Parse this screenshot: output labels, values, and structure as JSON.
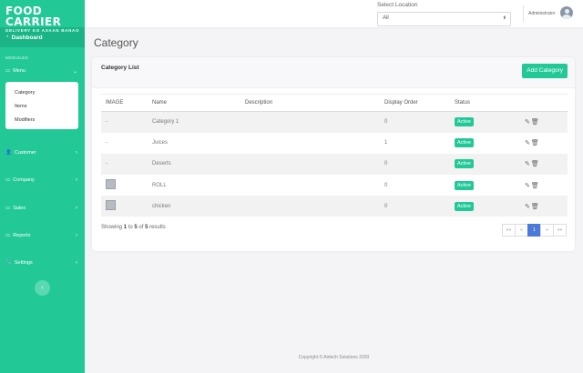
{
  "brand": {
    "title": "FOOD CARRIER",
    "subtitle": "DELIVERY KO ASAAN BANAO"
  },
  "sidebar": {
    "dashboard": "Dashboard",
    "modules_label": "MODULES",
    "menu": {
      "label": "Menu",
      "chevron": "⌄"
    },
    "submenu": [
      "Category",
      "Items",
      "Modifiers"
    ],
    "items": [
      {
        "label": "Customer",
        "icon": "user-icon",
        "glyph": "👤",
        "chevron": "›"
      },
      {
        "label": "Company",
        "icon": "folder-icon",
        "glyph": "▭",
        "chevron": "›"
      },
      {
        "label": "Sales",
        "icon": "folder-icon",
        "glyph": "▭",
        "chevron": "›"
      },
      {
        "label": "Reports",
        "icon": "folder-icon",
        "glyph": "▭",
        "chevron": "›"
      },
      {
        "label": "Settings",
        "icon": "wrench-icon",
        "glyph": "🔧",
        "chevron": "›"
      }
    ],
    "collapse": "‹"
  },
  "topbar": {
    "location_label": "Select Location",
    "location_value": "All",
    "location_arrow": "▲▼",
    "user": "Administrator"
  },
  "page_title": "Category",
  "card": {
    "title": "Category List",
    "add_button": "Add Category"
  },
  "table": {
    "columns": [
      "IMAGE",
      "Name",
      "Description",
      "Display Order",
      "Status",
      ""
    ],
    "rows": [
      {
        "image": "-",
        "name": "Category 1",
        "description": "",
        "order": "0",
        "status": "Active"
      },
      {
        "image": "-",
        "name": "Juices",
        "description": "",
        "order": "1",
        "status": "Active"
      },
      {
        "image": "-",
        "name": "Deserts",
        "description": "",
        "order": "0",
        "status": "Active"
      },
      {
        "image": "thumb",
        "name": "ROLL",
        "description": "",
        "order": "0",
        "status": "Active"
      },
      {
        "image": "thumb",
        "name": "chicken",
        "description": "",
        "order": "0",
        "status": "Active"
      }
    ],
    "actions": "✎🗑"
  },
  "pagination": {
    "showing_prefix": "Showing ",
    "from": "1",
    "to_word": " to ",
    "to": "5",
    "of_word": " of ",
    "total": "5",
    "suffix": " results",
    "first": "««",
    "prev": "«",
    "current": "1",
    "next": "»",
    "last": "»»"
  },
  "footer": "Copyright © Airtech Solutions 2020",
  "colors": {
    "accent": "#22c997",
    "page_active": "#4b7bd8"
  }
}
